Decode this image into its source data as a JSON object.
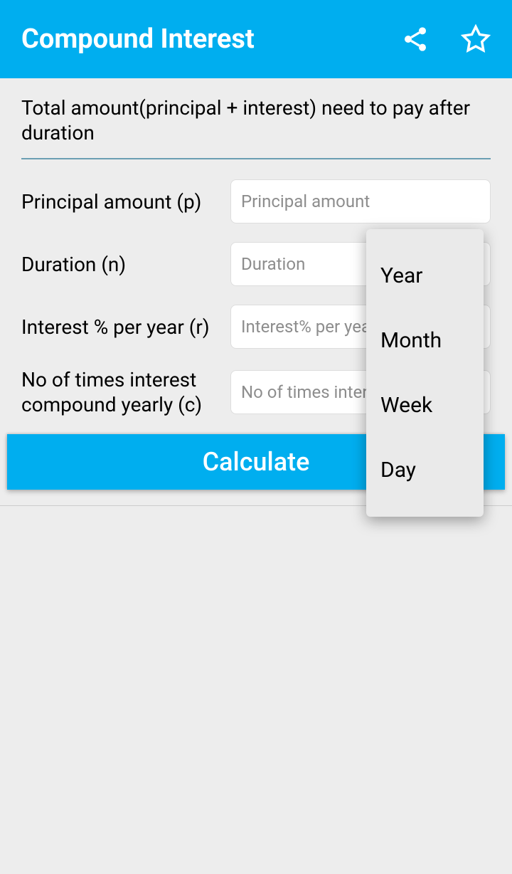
{
  "header": {
    "title": "Compound Interest"
  },
  "description": "Total amount(principal + interest) need to pay after duration",
  "fields": {
    "principal": {
      "label": "Principal amount (p)",
      "placeholder": "Principal amount"
    },
    "duration": {
      "label": "Duration (n)",
      "placeholder": "Duration"
    },
    "interest": {
      "label": "Interest % per year (r)",
      "placeholder": "Interest% per year"
    },
    "compound": {
      "label": "No of times interest compound yearly (c)",
      "placeholder": "No of times interest compound"
    }
  },
  "calculate_label": "Calculate",
  "dropdown": {
    "options": [
      "Year",
      "Month",
      "Week",
      "Day"
    ]
  }
}
